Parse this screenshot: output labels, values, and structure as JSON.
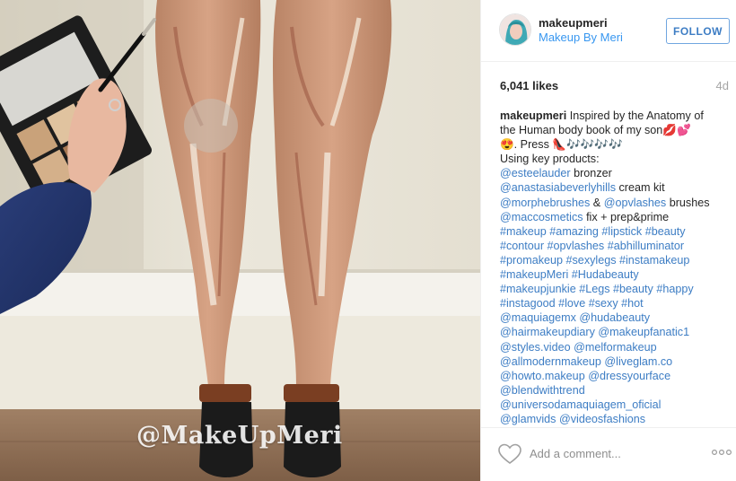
{
  "post": {
    "image": {
      "watermark": "@MakeUpMeri",
      "subject_icon": "legs-anatomy-photo"
    },
    "header": {
      "avatar_icon": "user-avatar",
      "username": "makeupmeri",
      "full_name": "Makeup By Meri",
      "follow_label": "FOLLOW"
    },
    "likes_label": "6,041 likes",
    "age": "4d",
    "caption": {
      "username": "makeupmeri",
      "text_1": "Inspired by the Anatomy of",
      "text_2": "the Human body book of my son💋💕",
      "text_3": "😍. Press 👠🎶🎶🎶🎶",
      "products_intro": "Using key products:",
      "products": [
        {
          "handle": "@esteelauder",
          "note": "bronzer"
        },
        {
          "handle": "@anastasiabeverlyhills",
          "note": "cream kit"
        },
        {
          "handle": "@morphebrushes",
          "mid": "&",
          "handle2": "@opvlashes",
          "note": "brushes"
        },
        {
          "handle": "@maccosmetics",
          "note": "fix + prep&prime"
        }
      ],
      "tag_lines": [
        "#makeup #amazing #lipstick #beauty",
        "#contour #opvlashes #abhilluminator",
        "#promakeup #sexylegs #instamakeup",
        "#makeupMeri #Hudabeauty",
        "#makeupjunkie #Legs #beauty #happy",
        "#instagood #love #sexy #hot",
        "@maquiagemx @hudabeauty",
        "@hairmakeupdiary @makeupfanatic1",
        "@styles.video @melformakeup",
        "@allmodernmakeup @liveglam.co",
        "@howto.makeup @dressyourface",
        "@blendwithtrend",
        "@universodamaquiagem_oficial",
        "@glamvids @videosfashions"
      ]
    },
    "footer": {
      "like_icon": "heart-icon",
      "comment_placeholder": "Add a comment...",
      "more_icon": "more-options-icon"
    },
    "colors": {
      "link": "#3d7dc4",
      "follow_border": "#70a6e0",
      "text": "#262626",
      "muted": "#a5a5a5"
    }
  }
}
